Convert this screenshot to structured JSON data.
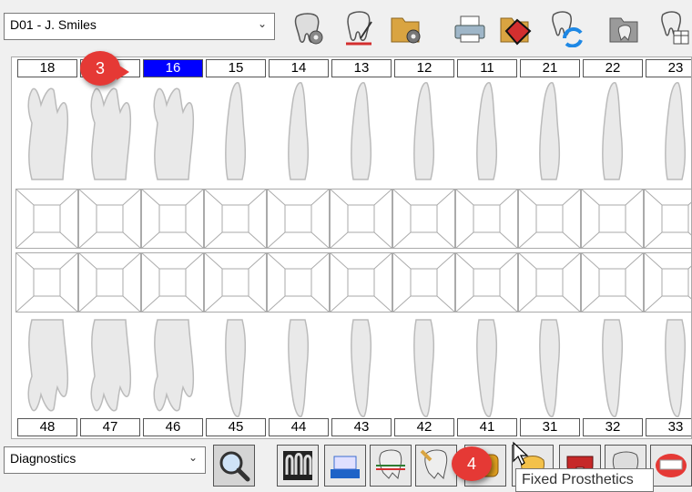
{
  "patient_select": {
    "value": "D01 - J. Smiles"
  },
  "toolbar": {
    "icons": [
      "tooth-settings-icon",
      "tooth-edit-icon",
      "folder-settings-icon",
      "printer-icon",
      "diamond-tool-icon",
      "tooth-refresh-icon",
      "folder-tooth-icon",
      "tooth-calendar-icon"
    ]
  },
  "upper_numbers": [
    "18",
    "17",
    "16",
    "15",
    "14",
    "13",
    "12",
    "11",
    "21",
    "22",
    "23"
  ],
  "lower_numbers": [
    "48",
    "47",
    "46",
    "45",
    "44",
    "43",
    "42",
    "41",
    "31",
    "32",
    "33"
  ],
  "selected_tooth": "16",
  "mode_select": {
    "value": "Diagnostics"
  },
  "bottom_buttons": [
    "xray-teeth-icon",
    "toothbrush-icon",
    "tooth-layers-icon",
    "tooth-implant-icon",
    "fixed-prosthetics-icon",
    "crown-icon",
    "bridge-icon",
    "denture-icon",
    "full-denture-icon"
  ],
  "badges": {
    "step3": "3",
    "step4": "4"
  },
  "tooltip": {
    "text": "Fixed Prosthetics"
  },
  "colors": {
    "selected": "#0000ff",
    "badge": "#e53935"
  }
}
